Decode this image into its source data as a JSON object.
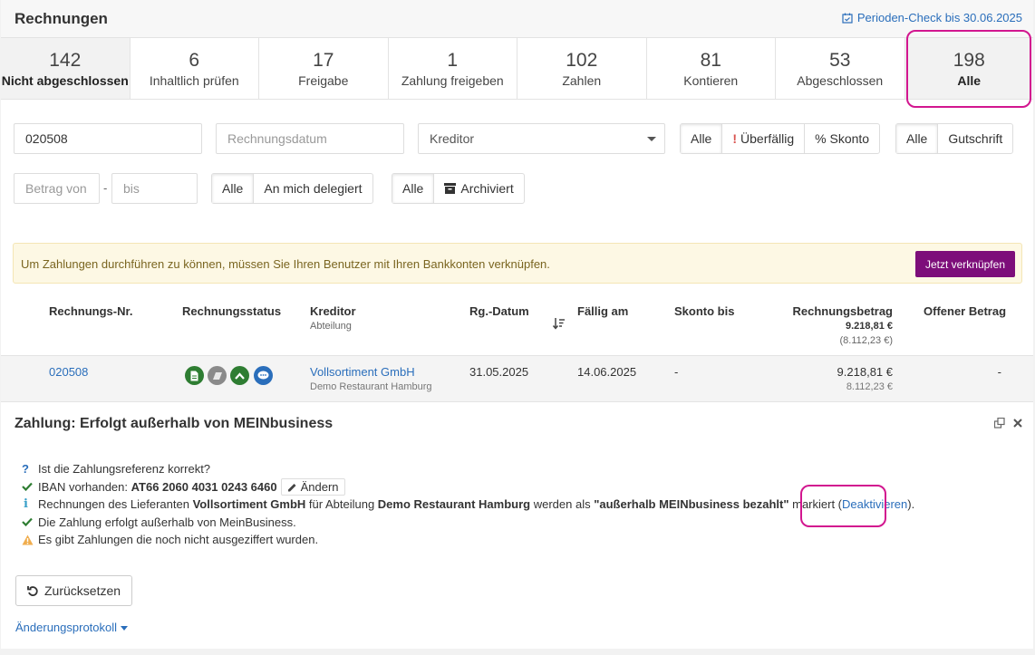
{
  "header": {
    "title": "Rechnungen",
    "period_check": "Perioden-Check bis 30.06.2025"
  },
  "tabs": [
    {
      "count": "142",
      "label": "Nicht abgeschlossen"
    },
    {
      "count": "6",
      "label": "Inhaltlich prüfen"
    },
    {
      "count": "17",
      "label": "Freigabe"
    },
    {
      "count": "1",
      "label": "Zahlung freigeben"
    },
    {
      "count": "102",
      "label": "Zahlen"
    },
    {
      "count": "81",
      "label": "Kontieren"
    },
    {
      "count": "53",
      "label": "Abgeschlossen"
    },
    {
      "count": "198",
      "label": "Alle"
    }
  ],
  "filters": {
    "invoice_number_value": "020508",
    "invoice_date_placeholder": "Rechnungsdatum",
    "creditor_placeholder": "Kreditor",
    "due_group": {
      "all": "Alle",
      "overdue": "Überfällig",
      "discount": "% Skonto"
    },
    "type_group": {
      "all": "Alle",
      "credit": "Gutschrift"
    },
    "amount_from_placeholder": "Betrag von",
    "amount_separator": "-",
    "amount_to_placeholder": "bis",
    "delegate_group": {
      "all": "Alle",
      "delegated": "An mich delegiert"
    },
    "archive_group": {
      "all": "Alle",
      "archived": "Archiviert"
    }
  },
  "alert": {
    "text": "Um Zahlungen durchführen zu können, müssen Sie Ihren Benutzer mit Ihren Bankkonten verknüpfen.",
    "button": "Jetzt verknüpfen"
  },
  "table": {
    "headers": {
      "number": "Rechnungs-Nr.",
      "status": "Rechnungsstatus",
      "creditor": "Kreditor",
      "creditor_sub": "Abteilung",
      "date": "Rg.-Datum",
      "due": "Fällig am",
      "discount": "Skonto bis",
      "amount": "Rechnungsbetrag",
      "amount_total": "9.218,81 €",
      "amount_net": "(8.112,23 €)",
      "open": "Offener Betrag"
    },
    "row": {
      "number": "020508",
      "creditor": "Vollsortiment GmbH",
      "department": "Demo Restaurant Hamburg",
      "date": "31.05.2025",
      "due": "14.06.2025",
      "discount": "-",
      "amount": "9.218,81 €",
      "amount_net": "8.112,23 €",
      "open": "-"
    }
  },
  "detail": {
    "title": "Zahlung: Erfolgt außerhalb von MEINbusiness",
    "q1": "Ist die Zahlungsreferenz korrekt?",
    "iban_prefix": "IBAN vorhanden: ",
    "iban": "AT66 2060 4031 0243 6460",
    "change_button": "Ändern",
    "info_pre": "Rechnungen des Lieferanten ",
    "info_supplier": "Vollsortiment GmbH",
    "info_mid": " für Abteilung ",
    "info_dept": "Demo Restaurant Hamburg",
    "info_mid2": " werden als ",
    "info_quote": "\"außerhalb MEINbusiness bezahlt\"",
    "info_post": " markiert (",
    "info_link": "Deaktivieren",
    "info_end": ").",
    "ok_line": "Die Zahlung erfolgt außerhalb von MeinBusiness.",
    "warn_line": "Es gibt Zahlungen die noch nicht ausgeziffert wurden.",
    "reset_button": "Zurücksetzen",
    "protocol_link": "Änderungsprotokoll"
  },
  "colors": {
    "accent_link": "#2a6ebb",
    "cta": "#7d0e7a",
    "highlight": "#d2168f",
    "success": "#2e7d32",
    "warning": "#f0ad4e"
  }
}
